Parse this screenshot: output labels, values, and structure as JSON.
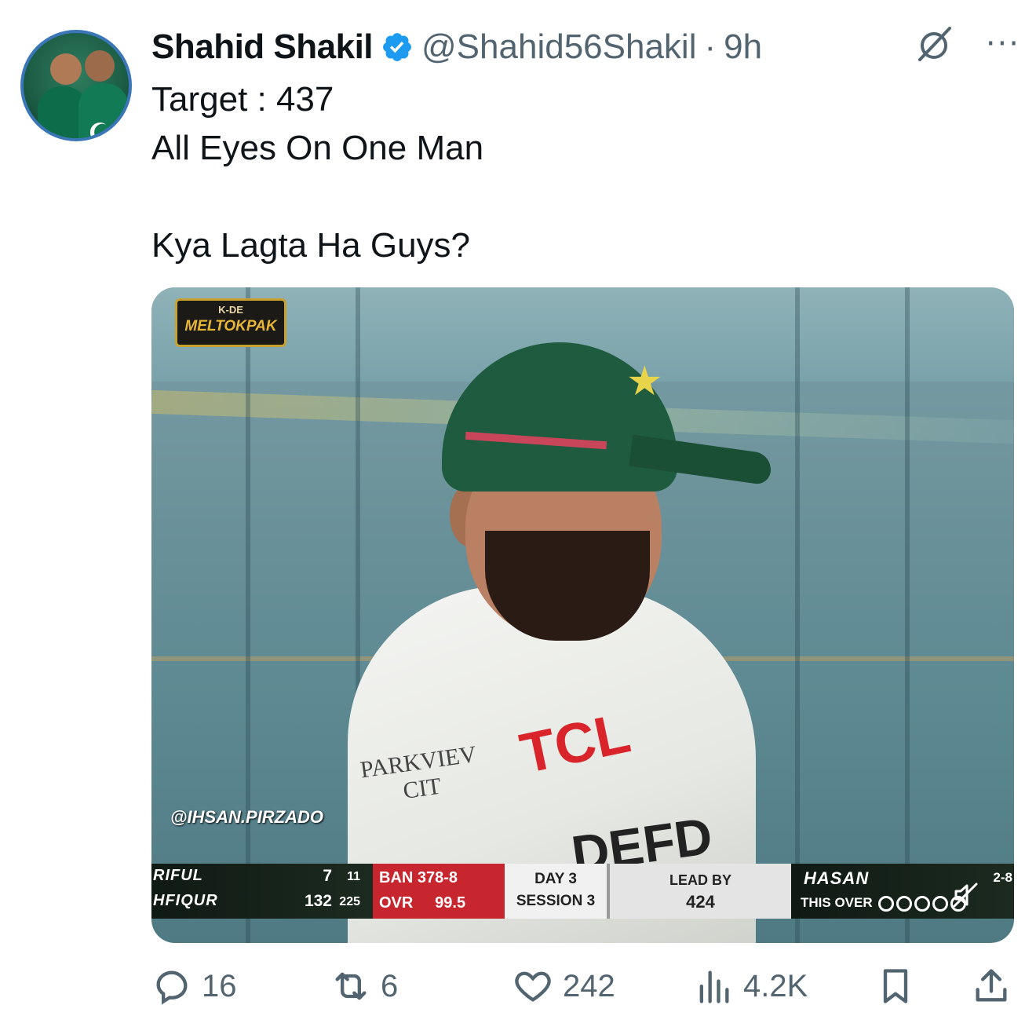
{
  "author": {
    "name": "Shahid Shakil",
    "handle": "@Shahid56Shakil",
    "separator": "·",
    "time": "9h"
  },
  "tweet": {
    "lines": [
      "Target : 437",
      "All Eyes On One Man",
      "",
      "Kya Lagta Ha Guys?"
    ]
  },
  "media": {
    "logo_small": "K-DE",
    "logo_main": "MELTOKPAK",
    "watermark": "@IHSAN.PIRZADO",
    "jersey": {
      "sponsor_line1": "PARKVIEV",
      "sponsor_line2": "CIT",
      "brand": "TCL",
      "partial": "DEFD"
    },
    "scorebar": {
      "batter1_name": "RIFUL",
      "batter1_runs": "7",
      "batter1_balls": "11",
      "batter2_name": "HFIQUR",
      "batter2_runs": "132",
      "batter2_balls": "225",
      "team_score": "BAN 378-8",
      "overs_label": "OVR",
      "overs_value": "99.5",
      "day": "DAY 3",
      "session": "SESSION 3",
      "lead_label": "LEAD BY",
      "lead_value": "424",
      "bowler_name": "HASAN",
      "bowler_figures": "2-8",
      "this_over_label": "THIS OVER"
    }
  },
  "actions": {
    "replies": "16",
    "reposts": "6",
    "likes": "242",
    "views": "4.2K"
  },
  "colors": {
    "verified": "#1d9bf0",
    "muted_text": "#536471",
    "team_red": "#c8262e"
  },
  "icons": [
    "verified-badge-icon",
    "grok-icon",
    "more-icon",
    "mute-icon",
    "reply-icon",
    "repost-icon",
    "like-icon",
    "views-icon",
    "bookmark-icon",
    "share-icon"
  ]
}
